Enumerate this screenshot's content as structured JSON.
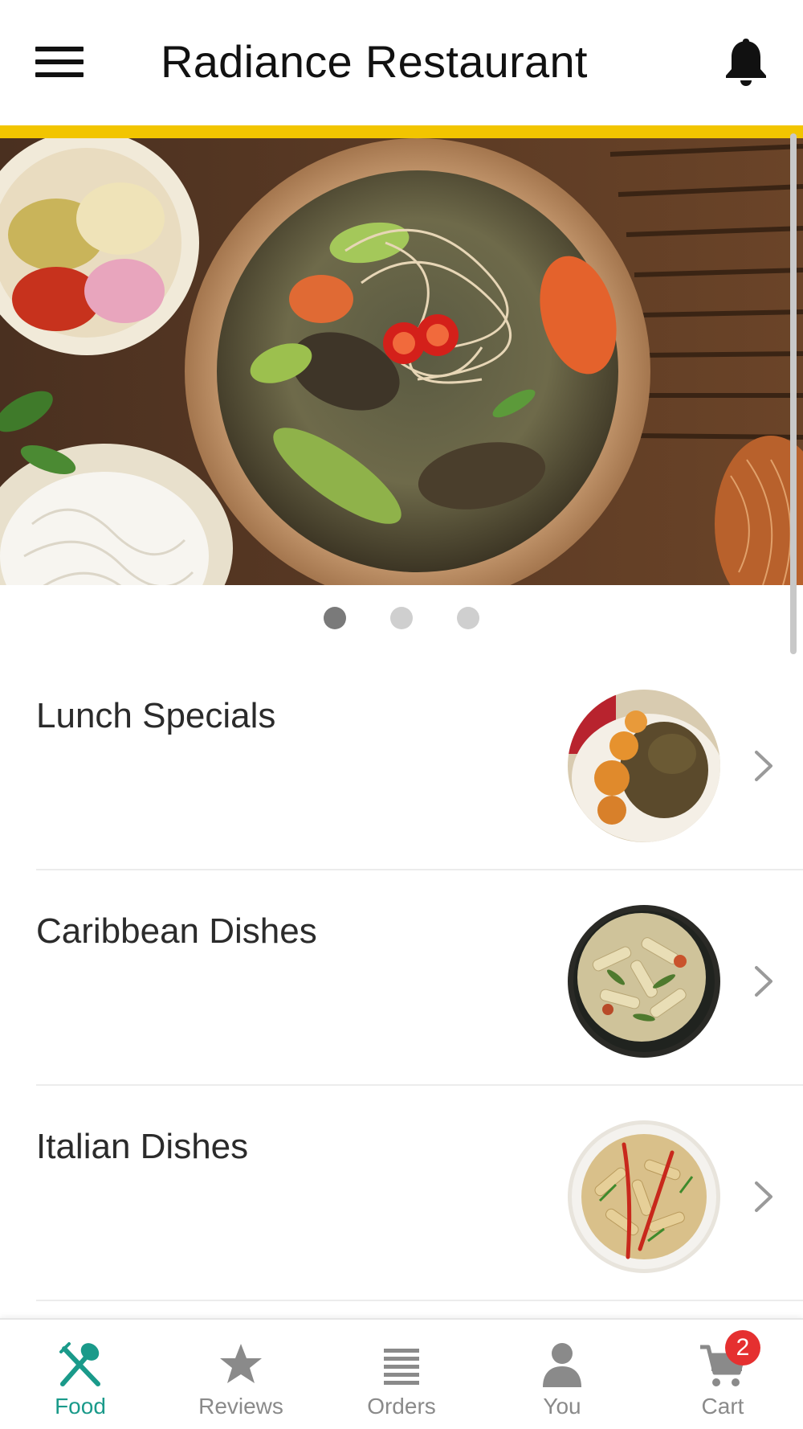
{
  "header": {
    "title": "Radiance Restaurant",
    "menu_icon": "hamburger-menu-icon",
    "notification_icon": "bell-icon"
  },
  "colors": {
    "accent": "#f2c500",
    "active_tab": "#1a9a8a",
    "inactive_tab": "#8a8a8a",
    "badge": "#e53030"
  },
  "carousel": {
    "slide_count": 3,
    "active_index": 0
  },
  "menu": {
    "items": [
      {
        "label": "Lunch Specials",
        "icon": "chevron-right-icon"
      },
      {
        "label": "Caribbean Dishes",
        "icon": "chevron-right-icon"
      },
      {
        "label": "Italian Dishes",
        "icon": "chevron-right-icon"
      }
    ]
  },
  "bottom_nav": {
    "items": [
      {
        "label": "Food",
        "icon": "fork-spoon-icon",
        "active": true
      },
      {
        "label": "Reviews",
        "icon": "star-icon",
        "active": false
      },
      {
        "label": "Orders",
        "icon": "list-icon",
        "active": false
      },
      {
        "label": "You",
        "icon": "user-icon",
        "active": false
      },
      {
        "label": "Cart",
        "icon": "cart-icon",
        "active": false
      }
    ],
    "cart_badge": "2"
  }
}
